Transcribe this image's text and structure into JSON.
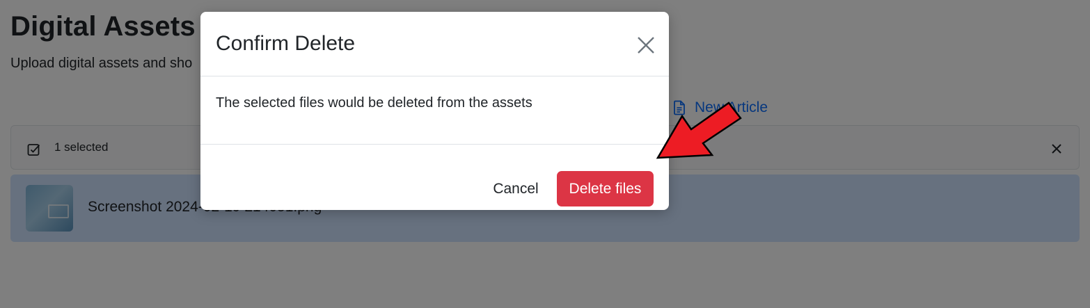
{
  "page": {
    "title": "Digital Assets",
    "subtitle": "Upload digital assets and sho",
    "new_article_label": "New Article"
  },
  "selection_bar": {
    "label": "1 selected"
  },
  "assets": [
    {
      "file_name": "Screenshot 2024-02-19 214051.png"
    }
  ],
  "modal": {
    "title": "Confirm Delete",
    "body": "The selected files would be deleted from the assets",
    "cancel_label": "Cancel",
    "delete_label": "Delete files"
  },
  "colors": {
    "danger": "#dc3545",
    "link": "#0d6efd",
    "selected_row": "#cfe2ff",
    "annotation_arrow": "#ed1c24"
  },
  "icons": {
    "modal_close": "close-icon",
    "selection_check": "checkbox-checked-icon",
    "selection_clear": "close-icon",
    "new_article": "document-icon",
    "annotation": "arrow-pointer-annotation"
  }
}
